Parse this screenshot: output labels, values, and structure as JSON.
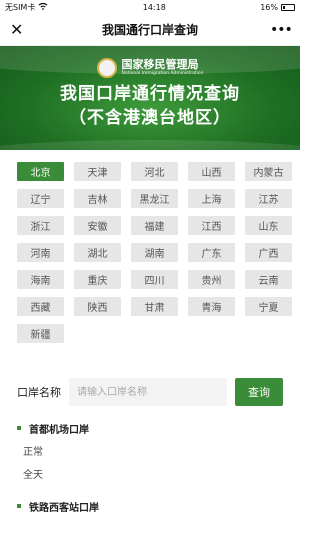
{
  "status_bar": {
    "carrier": "无SIM卡",
    "time": "14:18",
    "battery": "16%"
  },
  "nav": {
    "close_glyph": "✕",
    "title": "我国通行口岸查询",
    "more_glyph": "•••"
  },
  "banner": {
    "agency_cn": "国家移民管理局",
    "agency_en": "National Immigration Administration",
    "title_line1": "我国口岸通行情况查询",
    "title_line2": "（不含港澳台地区）"
  },
  "regions": [
    "北京",
    "天津",
    "河北",
    "山西",
    "内蒙古",
    "辽宁",
    "吉林",
    "黑龙江",
    "上海",
    "江苏",
    "浙江",
    "安徽",
    "福建",
    "江西",
    "山东",
    "河南",
    "湖北",
    "湖南",
    "广东",
    "广西",
    "海南",
    "重庆",
    "四川",
    "贵州",
    "云南",
    "西藏",
    "陕西",
    "甘肃",
    "青海",
    "宁夏",
    "新疆"
  ],
  "selected_region": "北京",
  "search": {
    "label": "口岸名称",
    "placeholder": "请输入口岸名称",
    "button": "查询"
  },
  "ports": [
    {
      "name": "首都机场口岸",
      "status": "正常",
      "hours": "全天"
    },
    {
      "name": "铁路西客站口岸"
    }
  ],
  "colors": {
    "accent": "#3a8c38",
    "chip_bg": "#e6e6e6"
  }
}
